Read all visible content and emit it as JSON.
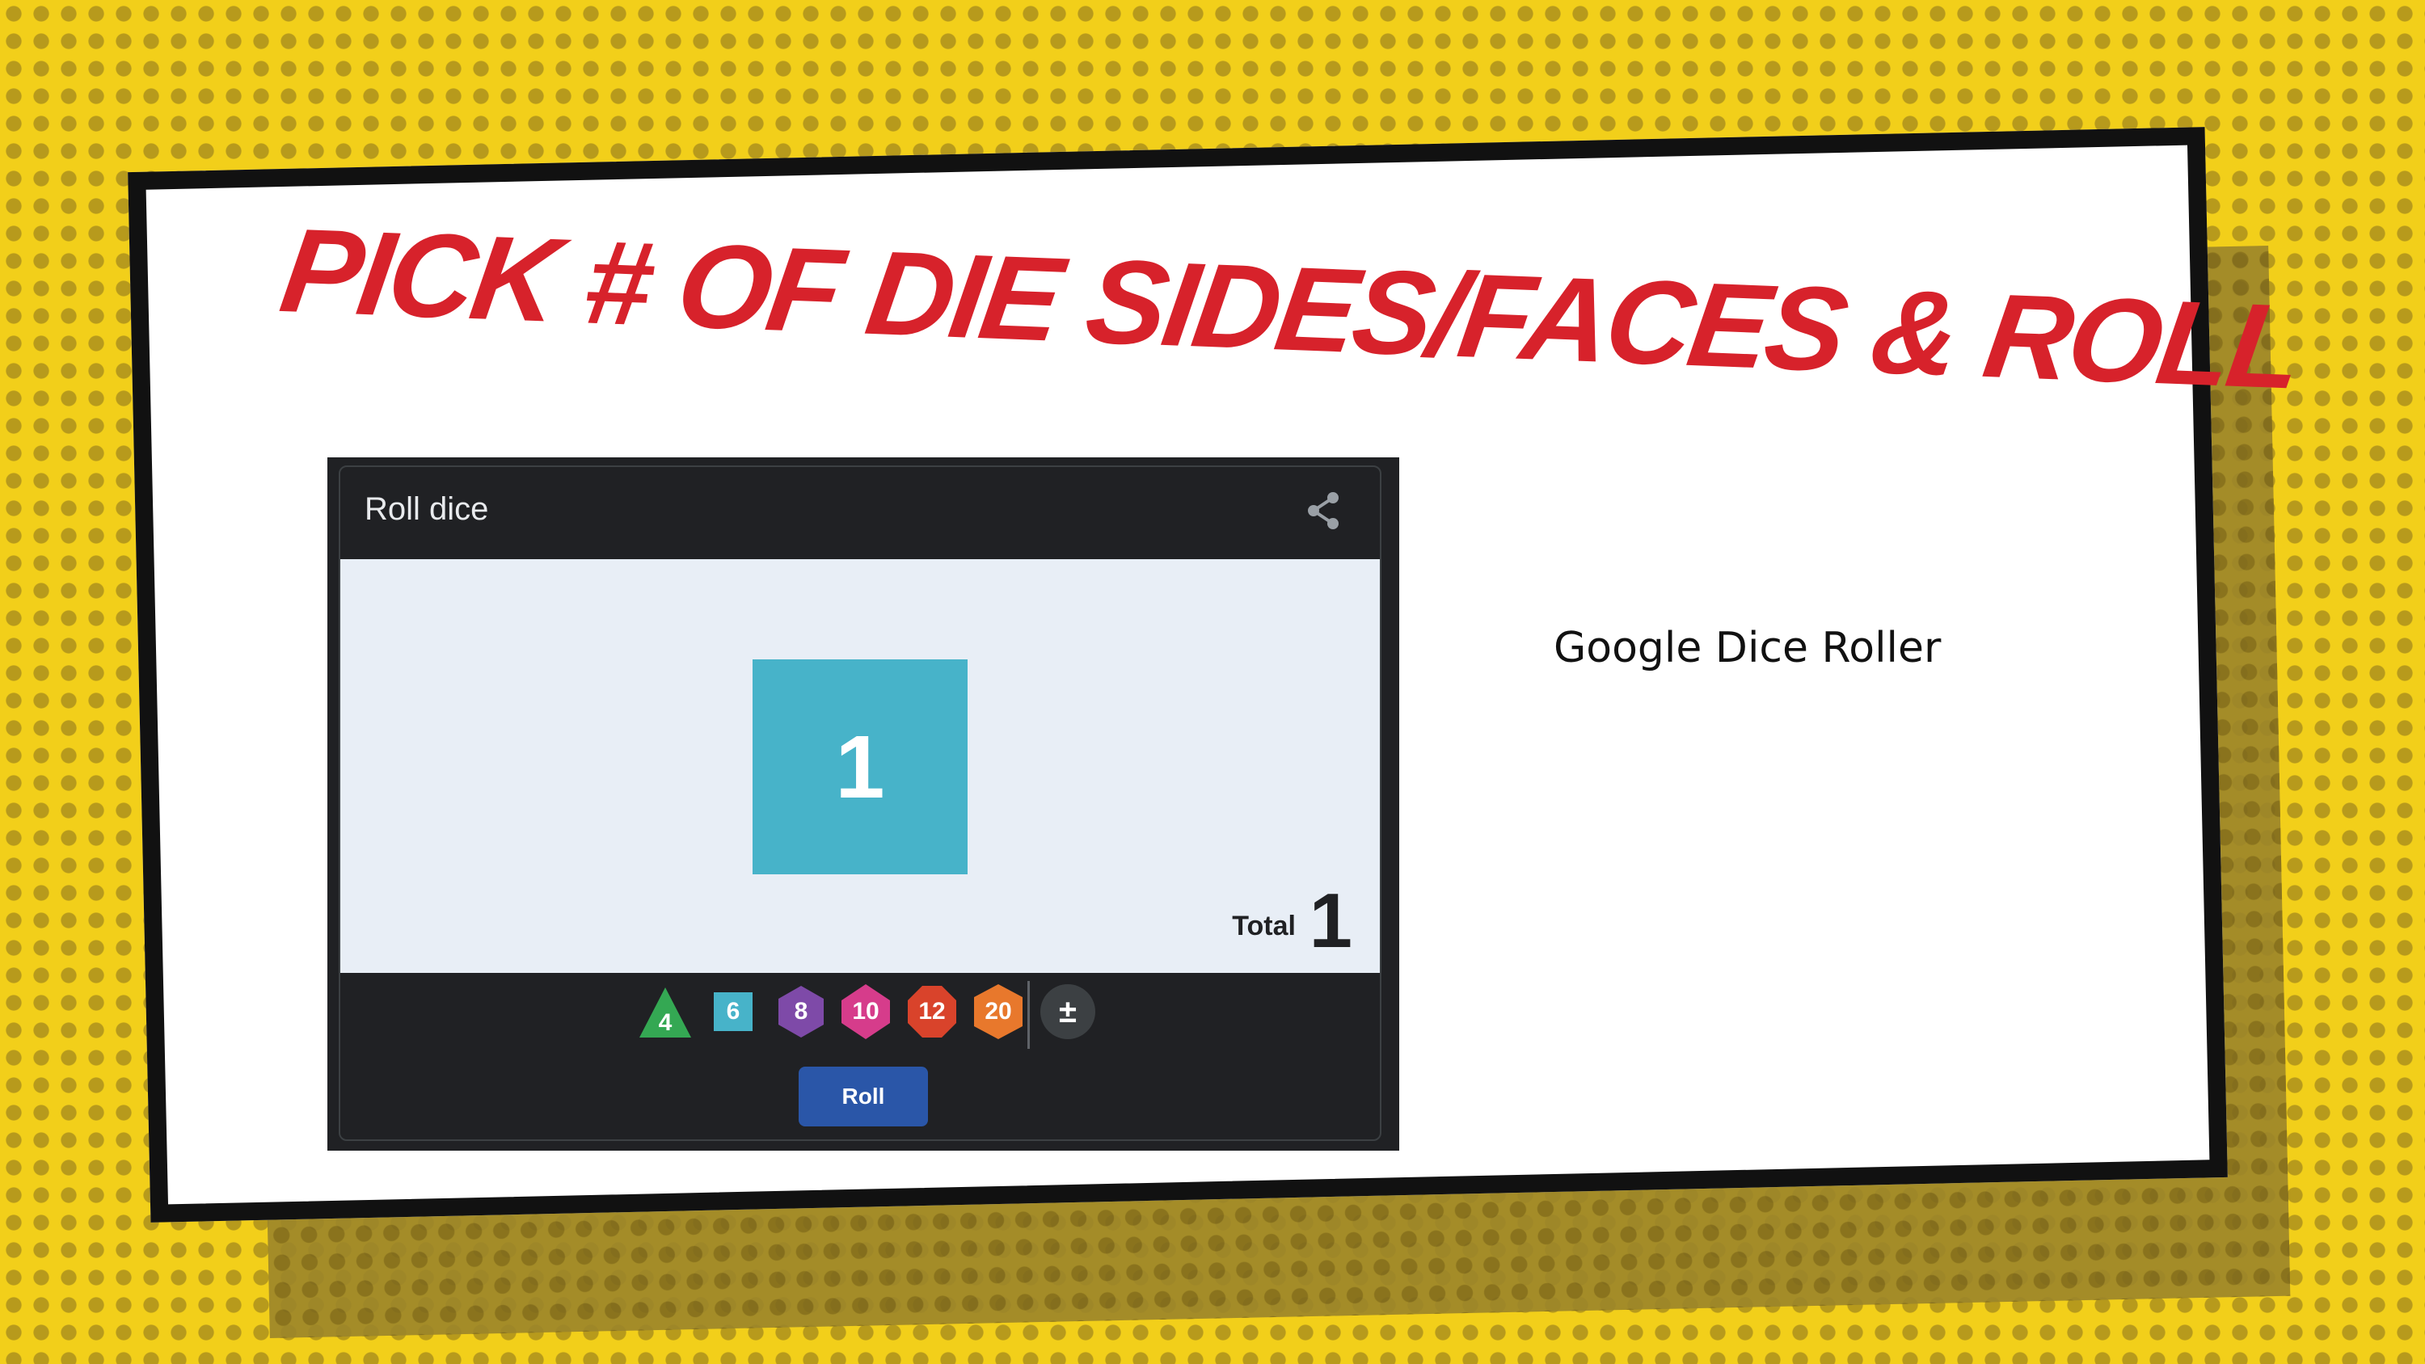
{
  "slide": {
    "title": "Pick # of die sides/faces & roll",
    "caption": "Google Dice Roller"
  },
  "widget": {
    "title": "Roll dice",
    "share_icon": "share-icon",
    "result_value": "1",
    "total_label": "Total",
    "total_value": "1",
    "dice": [
      {
        "label": "4",
        "shape": "triangle",
        "color": "#34a853"
      },
      {
        "label": "6",
        "shape": "square",
        "color": "#47b3c9"
      },
      {
        "label": "8",
        "shape": "hexagon",
        "color": "#7e4aa8"
      },
      {
        "label": "10",
        "shape": "hexagon",
        "color": "#d63c8b"
      },
      {
        "label": "12",
        "shape": "hexagon",
        "color": "#d9432b"
      },
      {
        "label": "20",
        "shape": "hexagon",
        "color": "#e8782c"
      }
    ],
    "modifier_label": "±",
    "roll_label": "Roll"
  },
  "colors": {
    "background_yellow": "#f2cf1a",
    "title_red": "#d7222b",
    "widget_dark": "#202124",
    "result_die": "#47b3c9",
    "roll_button": "#2a56a8"
  }
}
